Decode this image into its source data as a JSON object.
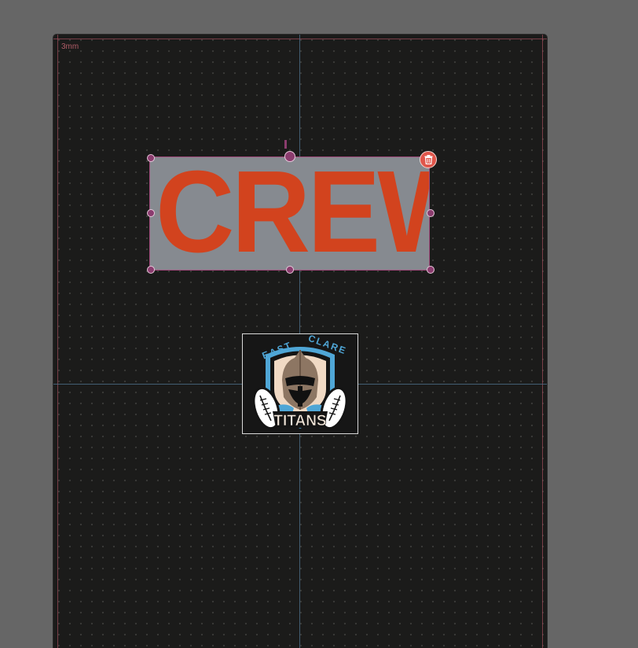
{
  "canvas": {
    "bleed_label": "3mm"
  },
  "text_object": {
    "text": "CREW",
    "text_color": "#d2431e",
    "background_color": "#868a90"
  },
  "selection": {
    "handle_color": "#8b3c6e",
    "delete_icon": "trash-icon"
  },
  "logo": {
    "arc_text_left": "EAST",
    "arc_text_right": "CLARE",
    "banner_text": "TITANS",
    "accent_color": "#4fa6d6"
  }
}
